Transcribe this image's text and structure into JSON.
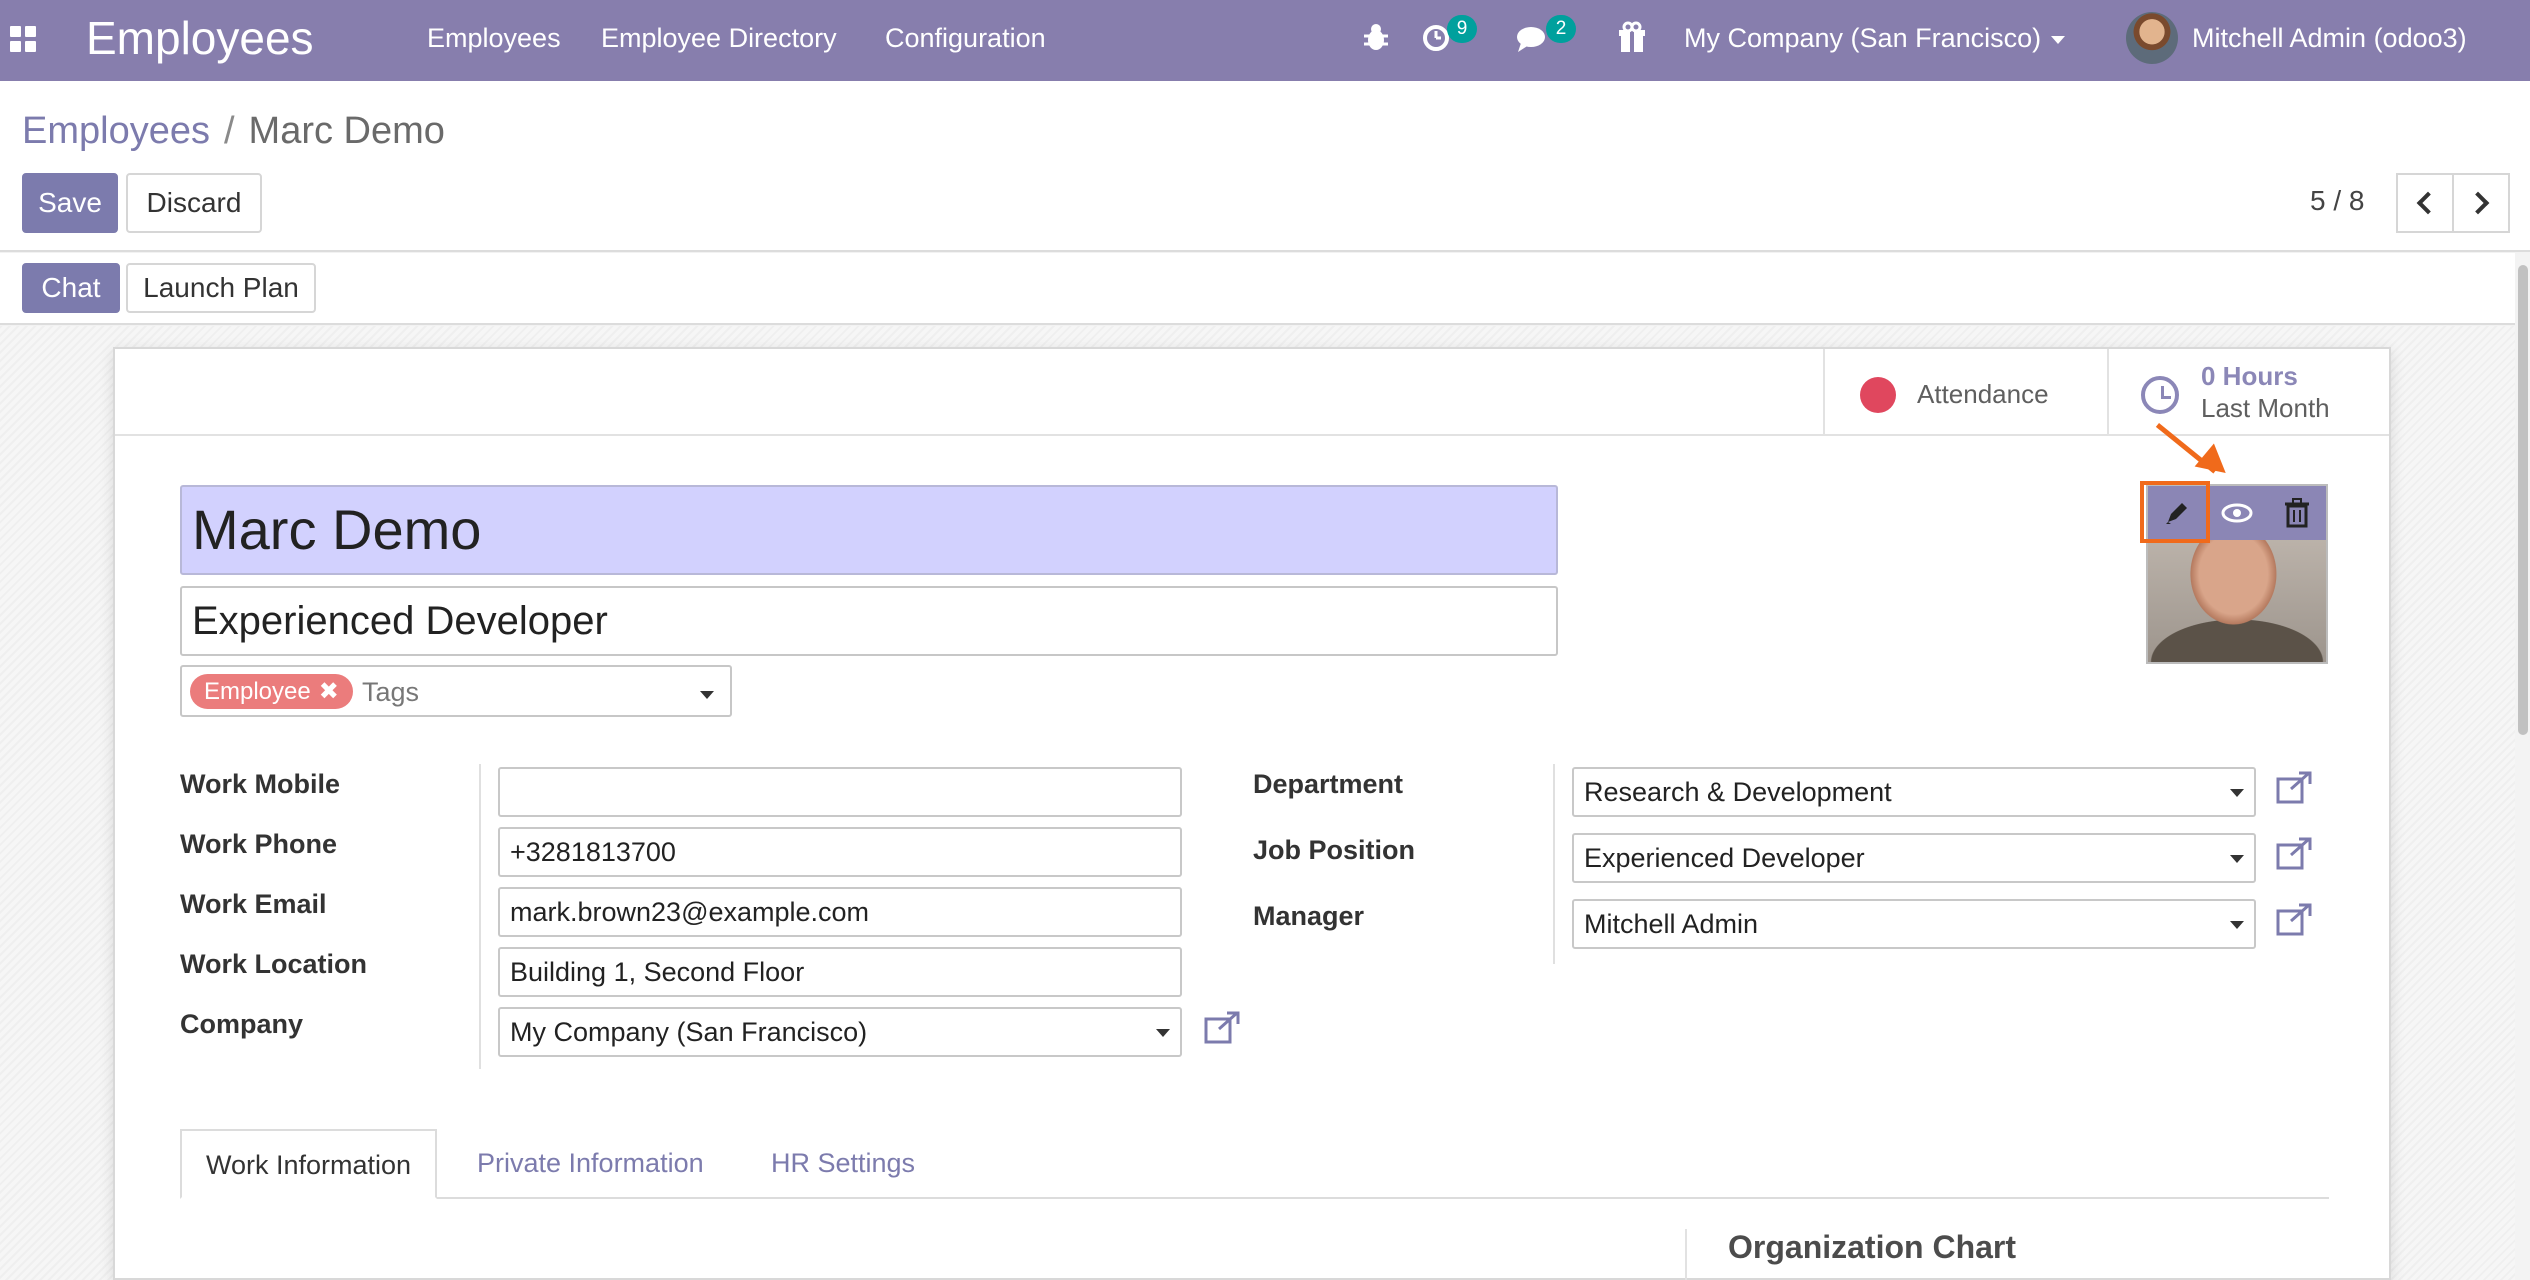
{
  "navbar": {
    "brand": "Employees",
    "menu": [
      "Employees",
      "Employee Directory",
      "Configuration"
    ],
    "activity_badge": "9",
    "messages_badge": "2",
    "company": "My Company (San Francisco)",
    "user": "Mitchell Admin (odoo3)",
    "color": "#877ead"
  },
  "breadcrumb": {
    "parent": "Employees",
    "separator": "/",
    "current": "Marc Demo"
  },
  "actions": {
    "save": "Save",
    "discard": "Discard"
  },
  "pager": {
    "value": "5 / 8"
  },
  "header_buttons": {
    "chat": "Chat",
    "launch_plan": "Launch Plan"
  },
  "stat_buttons": {
    "attendance": "Attendance",
    "hours_value": "0 Hours",
    "hours_label": "Last Month"
  },
  "employee": {
    "name": "Marc Demo",
    "job_title": "Experienced Developer",
    "tag": "Employee",
    "tags_placeholder": "Tags"
  },
  "left_group": {
    "labels": {
      "work_mobile": "Work Mobile",
      "work_phone": "Work Phone",
      "work_email": "Work Email",
      "work_location": "Work Location",
      "company": "Company"
    },
    "values": {
      "work_mobile": "",
      "work_phone": "+3281813700",
      "work_email": "mark.brown23@example.com",
      "work_location": "Building 1, Second Floor",
      "company": "My Company (San Francisco)"
    }
  },
  "right_group": {
    "labels": {
      "department": "Department",
      "job_position": "Job Position",
      "manager": "Manager"
    },
    "values": {
      "department": "Research & Development",
      "job_position": "Experienced Developer",
      "manager": "Mitchell Admin"
    }
  },
  "tabs": {
    "work_information": "Work Information",
    "private_information": "Private Information",
    "hr_settings": "HR Settings"
  },
  "sections": {
    "organization_chart": "Organization Chart"
  },
  "colors": {
    "primary": "#7c7bad",
    "name_highlight": "#d2d1fe",
    "annotation": "#f06a1b",
    "tag": "#eb7c7c",
    "attendance_dot": "#e0475e"
  }
}
